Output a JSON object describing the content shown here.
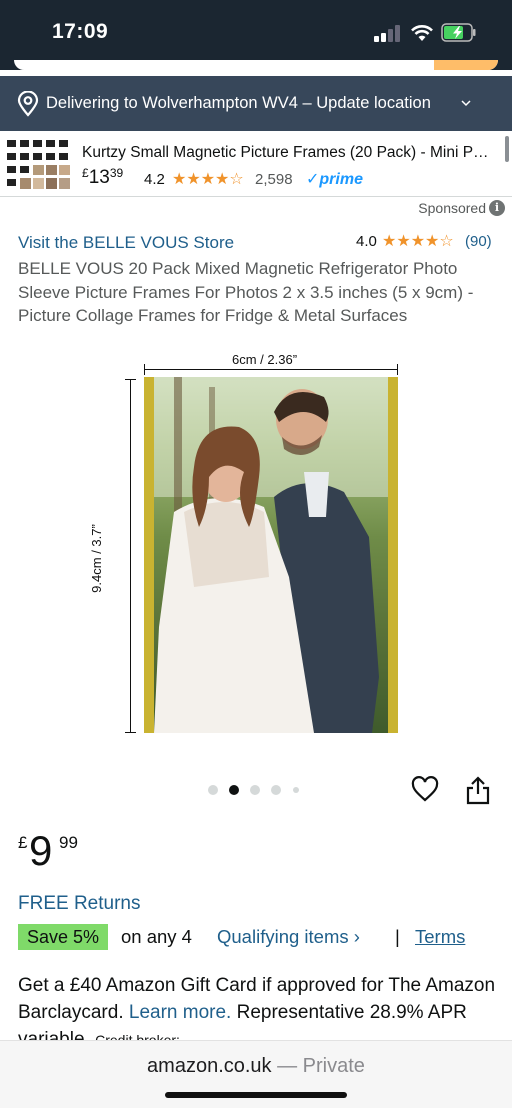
{
  "status_bar": {
    "time": "17:09"
  },
  "delivery": {
    "text": "Delivering to Wolverhampton WV4 – Update location"
  },
  "sponsored_product": {
    "title": "Kurtzy Small Magnetic Picture Frames (20 Pack) - Mini P…",
    "price_currency": "£",
    "price_whole": "13",
    "price_cents": "39",
    "rating": "4.2",
    "stars": "★★★★☆",
    "rating_count": "2,598",
    "prime_label": "✓prime"
  },
  "sponsored_label": "Sponsored",
  "info_icon_glyph": "i",
  "store_link": "Visit the BELLE VOUS Store",
  "product_rating": {
    "value": "4.0",
    "stars": "★★★★☆",
    "count": "(90)"
  },
  "product_title": "BELLE VOUS 20 Pack Mixed Magnetic Refrigerator Photo Sleeve Picture Frames For Photos 2 x 3.5 inches (5 x 9cm) - Picture Collage Frames for Fridge & Metal Surfaces",
  "image": {
    "width_label": "6cm / 2.36”",
    "height_label": "9.4cm / 3.7”"
  },
  "carousel": {
    "count": 5,
    "active_index": 1
  },
  "price": {
    "currency": "£",
    "whole": "9",
    "cents": "99"
  },
  "free_returns": "FREE Returns",
  "save": {
    "badge": "Save 5%",
    "rest": "on any 4",
    "qualifying": "Qualifying items ›",
    "separator": "|",
    "terms": "Terms"
  },
  "gift_card": {
    "text": "Get a £40 Amazon Gift Card if approved for The Amazon Barclaycard.",
    "learn_more": "Learn more.",
    "apr": "Representative 28.9% APR variable.",
    "credit": "Credit broker:"
  },
  "url_bar": {
    "domain": "amazon.co.uk",
    "mode": "— Private"
  },
  "colors": {
    "link": "#1f5f8b",
    "star": "#f0932b",
    "save_badge": "#7fda69",
    "header": "#1b2631",
    "delivery_bar": "#37475a"
  }
}
